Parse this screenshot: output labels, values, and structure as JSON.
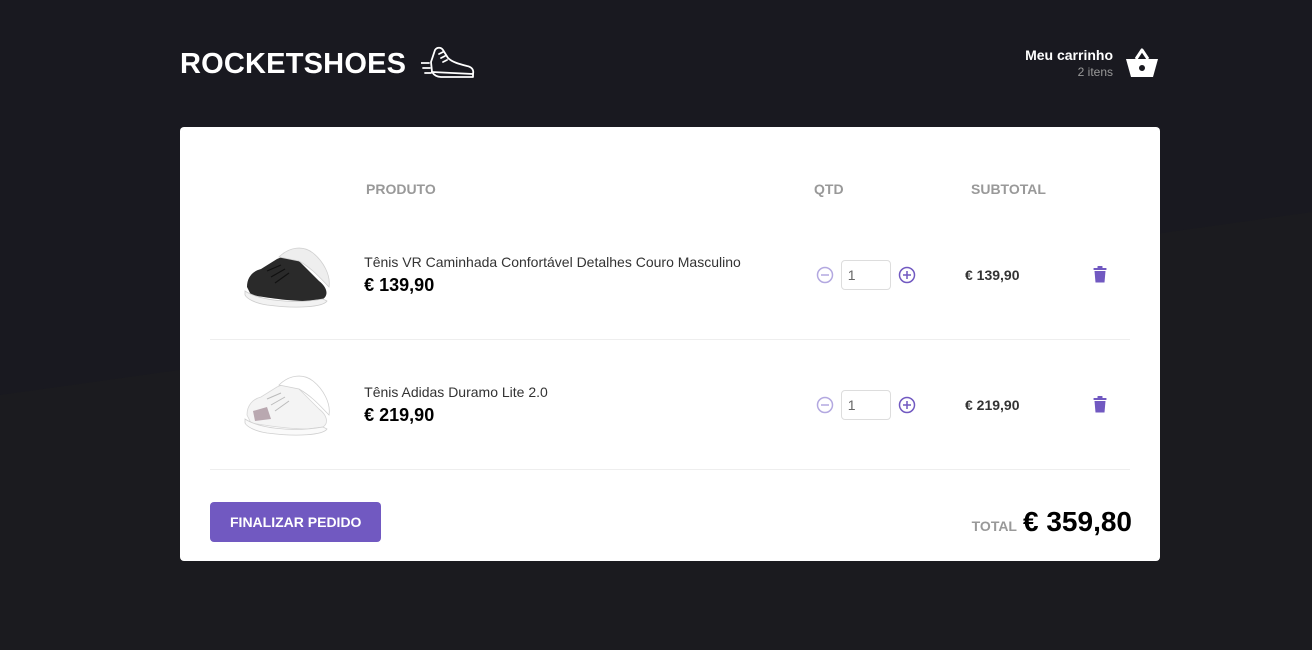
{
  "header": {
    "logo_text": "ROCKETSHOES",
    "logo_icon": "sneaker-icon",
    "cart_title": "Meu carrinho",
    "cart_count": "2 itens",
    "cart_icon": "basket-icon"
  },
  "table": {
    "headers": [
      "PRODUTO",
      "QTD",
      "SUBTOTAL"
    ],
    "items": [
      {
        "name": "Tênis VR Caminhada Confortável Detalhes Couro Masculino",
        "price": "€ 139,90",
        "quantity": "1",
        "subtotal": "€ 139,90",
        "image": "black-sneaker-image"
      },
      {
        "name": "Tênis Adidas Duramo Lite 2.0",
        "price": "€ 219,90",
        "quantity": "1",
        "subtotal": "€ 219,90",
        "image": "white-sneaker-image"
      }
    ]
  },
  "footer": {
    "finish_label": "FINALIZAR PEDIDO",
    "total_label": "TOTAL",
    "total_value": "€ 359,80"
  },
  "colors": {
    "background": "#191920",
    "accent": "#7159c1",
    "panel": "#ffffff"
  }
}
